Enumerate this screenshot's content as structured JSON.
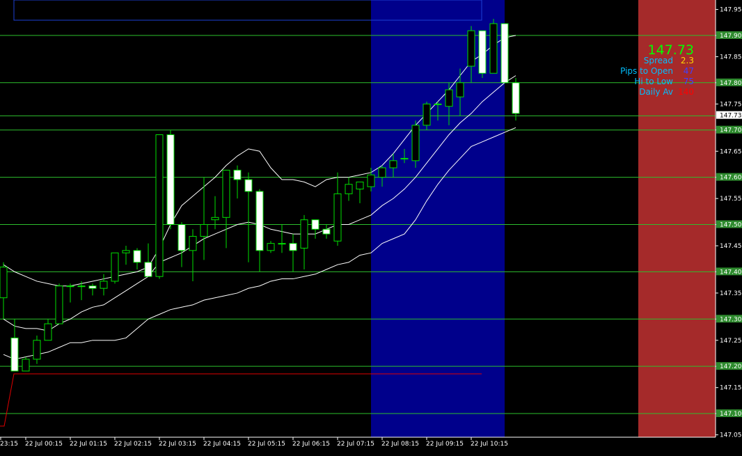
{
  "chart_data": {
    "type": "candlestick",
    "ylim": [
      147.05,
      147.975
    ],
    "price_ticks": [
      "147.955",
      "147.900",
      "147.855",
      "147.800",
      "147.755",
      "147.700",
      "147.655",
      "147.600",
      "147.555",
      "147.500",
      "147.455",
      "147.400",
      "147.355",
      "147.300",
      "147.255",
      "147.200",
      "147.155",
      "147.100",
      "147.055"
    ],
    "level_lines": [
      147.9,
      147.8,
      147.73,
      147.7,
      147.6,
      147.5,
      147.4,
      147.3,
      147.2,
      147.1
    ],
    "level_labels": [
      "147.900",
      "147.800",
      "147.700",
      "147.600",
      "147.500",
      "147.400",
      "147.300",
      "147.200",
      "147.100"
    ],
    "current_price": "147.731",
    "time_labels": [
      "23:15",
      "22 Jul 00:15",
      "22 Jul 01:15",
      "22 Jul 02:15",
      "22 Jul 03:15",
      "22 Jul 04:15",
      "22 Jul 05:15",
      "22 Jul 06:15",
      "22 Jul 07:15",
      "22 Jul 08:15",
      "22 Jul 09:15",
      "22 Jul 10:15"
    ],
    "candles": [
      {
        "o": 147.345,
        "h": 147.42,
        "l": 147.3,
        "c": 147.41
      },
      {
        "o": 147.26,
        "h": 147.3,
        "l": 147.19,
        "c": 147.19
      },
      {
        "o": 147.19,
        "h": 147.22,
        "l": 147.19,
        "c": 147.215
      },
      {
        "o": 147.215,
        "h": 147.265,
        "l": 147.205,
        "c": 147.255
      },
      {
        "o": 147.255,
        "h": 147.3,
        "l": 147.255,
        "c": 147.29
      },
      {
        "o": 147.29,
        "h": 147.375,
        "l": 147.29,
        "c": 147.37
      },
      {
        "o": 147.37,
        "h": 147.375,
        "l": 147.335,
        "c": 147.37
      },
      {
        "o": 147.37,
        "h": 147.38,
        "l": 147.34,
        "c": 147.37
      },
      {
        "o": 147.37,
        "h": 147.375,
        "l": 147.35,
        "c": 147.365
      },
      {
        "o": 147.365,
        "h": 147.395,
        "l": 147.35,
        "c": 147.38
      },
      {
        "o": 147.38,
        "h": 147.44,
        "l": 147.375,
        "c": 147.44
      },
      {
        "o": 147.44,
        "h": 147.455,
        "l": 147.415,
        "c": 147.445
      },
      {
        "o": 147.445,
        "h": 147.45,
        "l": 147.405,
        "c": 147.42
      },
      {
        "o": 147.42,
        "h": 147.46,
        "l": 147.395,
        "c": 147.39
      },
      {
        "o": 147.39,
        "h": 147.69,
        "l": 147.385,
        "c": 147.69
      },
      {
        "o": 147.69,
        "h": 147.7,
        "l": 147.49,
        "c": 147.5
      },
      {
        "o": 147.5,
        "h": 147.505,
        "l": 147.41,
        "c": 147.445
      },
      {
        "o": 147.445,
        "h": 147.49,
        "l": 147.38,
        "c": 147.475
      },
      {
        "o": 147.475,
        "h": 147.6,
        "l": 147.425,
        "c": 147.5
      },
      {
        "o": 147.51,
        "h": 147.56,
        "l": 147.49,
        "c": 147.515
      },
      {
        "o": 147.515,
        "h": 147.61,
        "l": 147.45,
        "c": 147.615
      },
      {
        "o": 147.615,
        "h": 147.625,
        "l": 147.555,
        "c": 147.595
      },
      {
        "o": 147.595,
        "h": 147.61,
        "l": 147.42,
        "c": 147.57
      },
      {
        "o": 147.57,
        "h": 147.575,
        "l": 147.4,
        "c": 147.445
      },
      {
        "o": 147.445,
        "h": 147.465,
        "l": 147.44,
        "c": 147.46
      },
      {
        "o": 147.46,
        "h": 147.5,
        "l": 147.44,
        "c": 147.46
      },
      {
        "o": 147.46,
        "h": 147.48,
        "l": 147.4,
        "c": 147.445
      },
      {
        "o": 147.45,
        "h": 147.52,
        "l": 147.405,
        "c": 147.51
      },
      {
        "o": 147.51,
        "h": 147.51,
        "l": 147.47,
        "c": 147.49
      },
      {
        "o": 147.49,
        "h": 147.5,
        "l": 147.47,
        "c": 147.48
      },
      {
        "o": 147.465,
        "h": 147.61,
        "l": 147.455,
        "c": 147.565
      },
      {
        "o": 147.565,
        "h": 147.6,
        "l": 147.55,
        "c": 147.585
      },
      {
        "o": 147.575,
        "h": 147.59,
        "l": 147.545,
        "c": 147.59
      },
      {
        "o": 147.58,
        "h": 147.62,
        "l": 147.57,
        "c": 147.605
      },
      {
        "o": 147.6,
        "h": 147.625,
        "l": 147.58,
        "c": 147.62
      },
      {
        "o": 147.62,
        "h": 147.65,
        "l": 147.6,
        "c": 147.635
      },
      {
        "o": 147.64,
        "h": 147.66,
        "l": 147.63,
        "c": 147.64
      },
      {
        "o": 147.635,
        "h": 147.72,
        "l": 147.62,
        "c": 147.71
      },
      {
        "o": 147.71,
        "h": 147.76,
        "l": 147.7,
        "c": 147.755
      },
      {
        "o": 147.755,
        "h": 147.76,
        "l": 147.72,
        "c": 147.755
      },
      {
        "o": 147.75,
        "h": 147.8,
        "l": 147.71,
        "c": 147.785
      },
      {
        "o": 147.77,
        "h": 147.83,
        "l": 147.73,
        "c": 147.8
      },
      {
        "o": 147.835,
        "h": 147.92,
        "l": 147.8,
        "c": 147.91
      },
      {
        "o": 147.91,
        "h": 147.91,
        "l": 147.81,
        "c": 147.82
      },
      {
        "o": 147.82,
        "h": 147.935,
        "l": 147.82,
        "c": 147.925
      },
      {
        "o": 147.925,
        "h": 147.925,
        "l": 147.8,
        "c": 147.8
      },
      {
        "o": 147.8,
        "h": 147.81,
        "l": 147.72,
        "c": 147.735
      }
    ],
    "band_upper": [
      147.415,
      147.4,
      147.39,
      147.38,
      147.375,
      147.37,
      147.37,
      147.375,
      147.38,
      147.385,
      147.39,
      147.395,
      147.4,
      147.41,
      147.45,
      147.5,
      147.54,
      147.56,
      147.58,
      147.6,
      147.625,
      147.645,
      147.66,
      147.655,
      147.62,
      147.595,
      147.595,
      147.59,
      147.58,
      147.595,
      147.6,
      147.6,
      147.605,
      147.61,
      147.625,
      147.65,
      147.68,
      147.71,
      147.735,
      147.76,
      147.785,
      147.815,
      147.845,
      147.86,
      147.88,
      147.895,
      147.9
    ],
    "band_middle": [
      147.3,
      147.285,
      147.28,
      147.28,
      147.275,
      147.29,
      147.3,
      147.315,
      147.325,
      147.33,
      147.345,
      147.36,
      147.375,
      147.39,
      147.42,
      147.43,
      147.44,
      147.455,
      147.47,
      147.48,
      147.49,
      147.5,
      147.505,
      147.5,
      147.49,
      147.485,
      147.48,
      147.48,
      147.48,
      147.49,
      147.5,
      147.5,
      147.51,
      147.52,
      147.54,
      147.555,
      147.575,
      147.6,
      147.63,
      147.66,
      147.69,
      147.715,
      147.735,
      147.76,
      147.78,
      147.8,
      147.815
    ],
    "band_lower": [
      147.225,
      147.215,
      147.22,
      147.225,
      147.23,
      147.24,
      147.25,
      147.25,
      147.255,
      147.255,
      147.255,
      147.26,
      147.28,
      147.3,
      147.31,
      147.32,
      147.325,
      147.33,
      147.34,
      147.345,
      147.35,
      147.355,
      147.365,
      147.37,
      147.38,
      147.385,
      147.385,
      147.39,
      147.395,
      147.405,
      147.415,
      147.42,
      147.435,
      147.44,
      147.46,
      147.47,
      147.48,
      147.51,
      147.55,
      147.585,
      147.615,
      147.64,
      147.665,
      147.675,
      147.685,
      147.695,
      147.705
    ]
  },
  "info_panel": {
    "price": "147.73",
    "rows": [
      {
        "label": "Spread",
        "value": "2.3",
        "color": "#ffd700"
      },
      {
        "label": "Pips to Open",
        "value": "47",
        "color": "#4040ff"
      },
      {
        "label": "Hi to Low",
        "value": "75",
        "color": "#4040ff"
      },
      {
        "label": "Daily Av",
        "value": "140",
        "color": "#ff0000"
      }
    ]
  },
  "colors": {
    "background": "#000000",
    "grid_line": "#2dbf2d",
    "candle_outline": "#00e000",
    "bull_fill": "#000000",
    "bear_fill": "#ffffff",
    "band": "#ffffff",
    "session_box": "#00008b",
    "right_box": "#a52a2a",
    "red_line": "#e00000",
    "info_price": "#00ff00",
    "info_label": "#00bfff"
  }
}
